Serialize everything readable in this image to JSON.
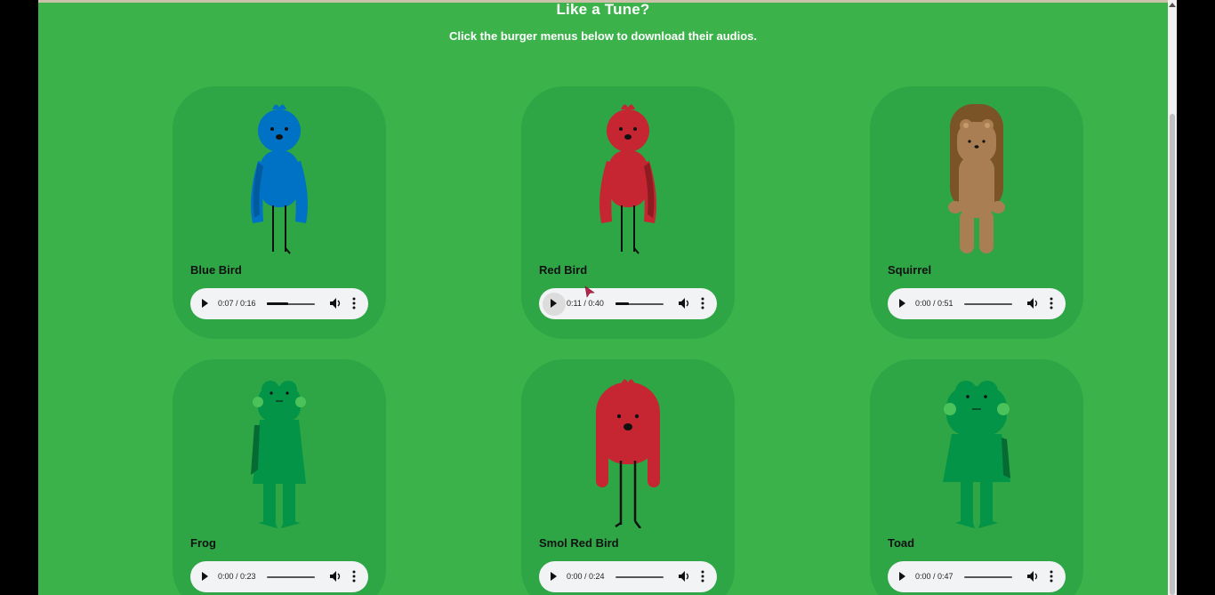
{
  "page": {
    "heading": "Like a Tune?",
    "subheading": "Click the burger menus below to download their audios."
  },
  "colors": {
    "background": "#3bb34a",
    "card": "#2ea646",
    "blue_bird": "#0072c6",
    "red_bird": "#c52632",
    "squirrel_fur": "#a87e52",
    "squirrel_hair": "#7a5326",
    "frog": "#039447"
  },
  "cards": [
    {
      "name": "Blue Bird",
      "character_icon": "blue-bird-icon",
      "time": "0:07 / 0:16",
      "progress": 0.44
    },
    {
      "name": "Red Bird",
      "character_icon": "red-bird-icon",
      "time": "0:11 / 0:40",
      "progress": 0.28
    },
    {
      "name": "Squirrel",
      "character_icon": "squirrel-icon",
      "time": "0:00 / 0:51",
      "progress": 0
    },
    {
      "name": "Frog",
      "character_icon": "frog-icon",
      "time": "0:00 / 0:23",
      "progress": 0
    },
    {
      "name": "Smol Red Bird",
      "character_icon": "smol-red-bird-icon",
      "time": "0:00 / 0:24",
      "progress": 0
    },
    {
      "name": "Toad",
      "character_icon": "toad-icon",
      "time": "0:00 / 0:47",
      "progress": 0
    }
  ],
  "player_icons": {
    "play": "play-icon",
    "volume": "volume-icon",
    "menu": "more-options-icon"
  }
}
